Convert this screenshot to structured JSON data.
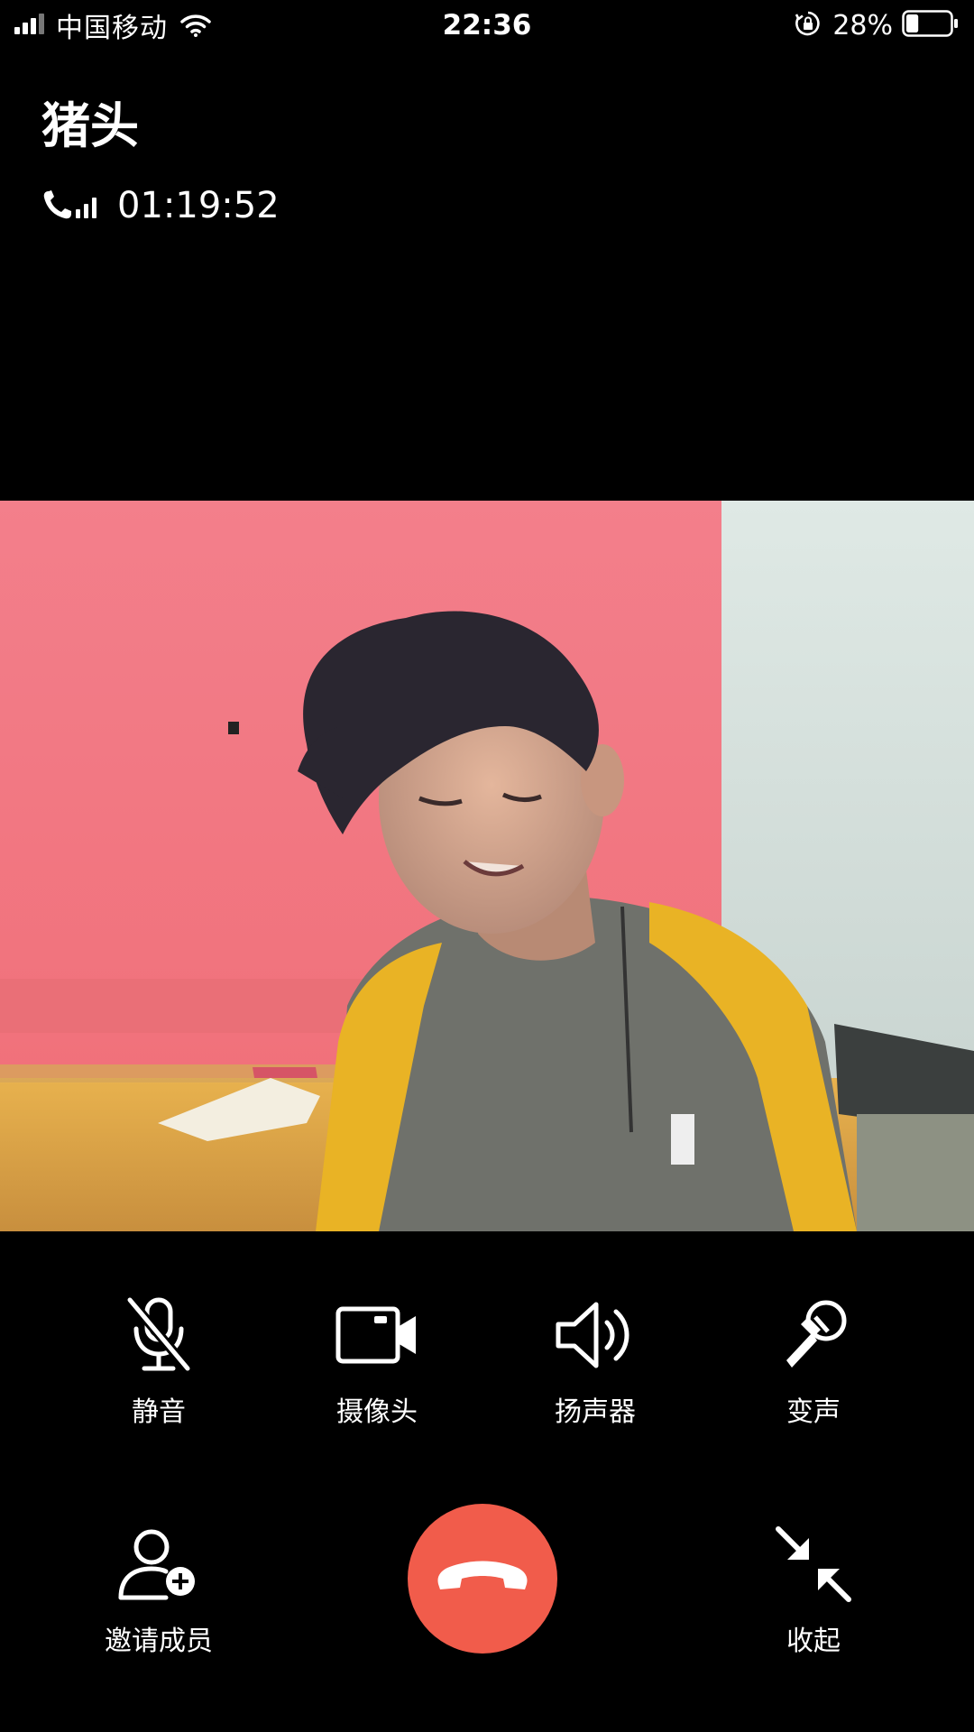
{
  "status_bar": {
    "carrier": "中国移动",
    "time": "22:36",
    "battery_percent": "28%",
    "battery_level": 0.28,
    "icons": [
      "signal-icon",
      "wifi-icon",
      "orientation-lock-icon",
      "battery-icon"
    ]
  },
  "call": {
    "contact_name": "猪头",
    "duration": "01:19:52",
    "quality_icon": "call-signal-icon"
  },
  "controls": {
    "mute": {
      "label": "静音",
      "icon": "mic-off-icon"
    },
    "camera": {
      "label": "摄像头",
      "icon": "camera-icon"
    },
    "speaker": {
      "label": "扬声器",
      "icon": "speaker-icon"
    },
    "voice_changer": {
      "label": "变声",
      "icon": "voice-changer-icon"
    },
    "invite": {
      "label": "邀请成员",
      "icon": "add-member-icon"
    },
    "hangup": {
      "icon": "hangup-icon",
      "color": "#f15c4b"
    },
    "minimize": {
      "label": "收起",
      "icon": "minimize-icon"
    }
  }
}
